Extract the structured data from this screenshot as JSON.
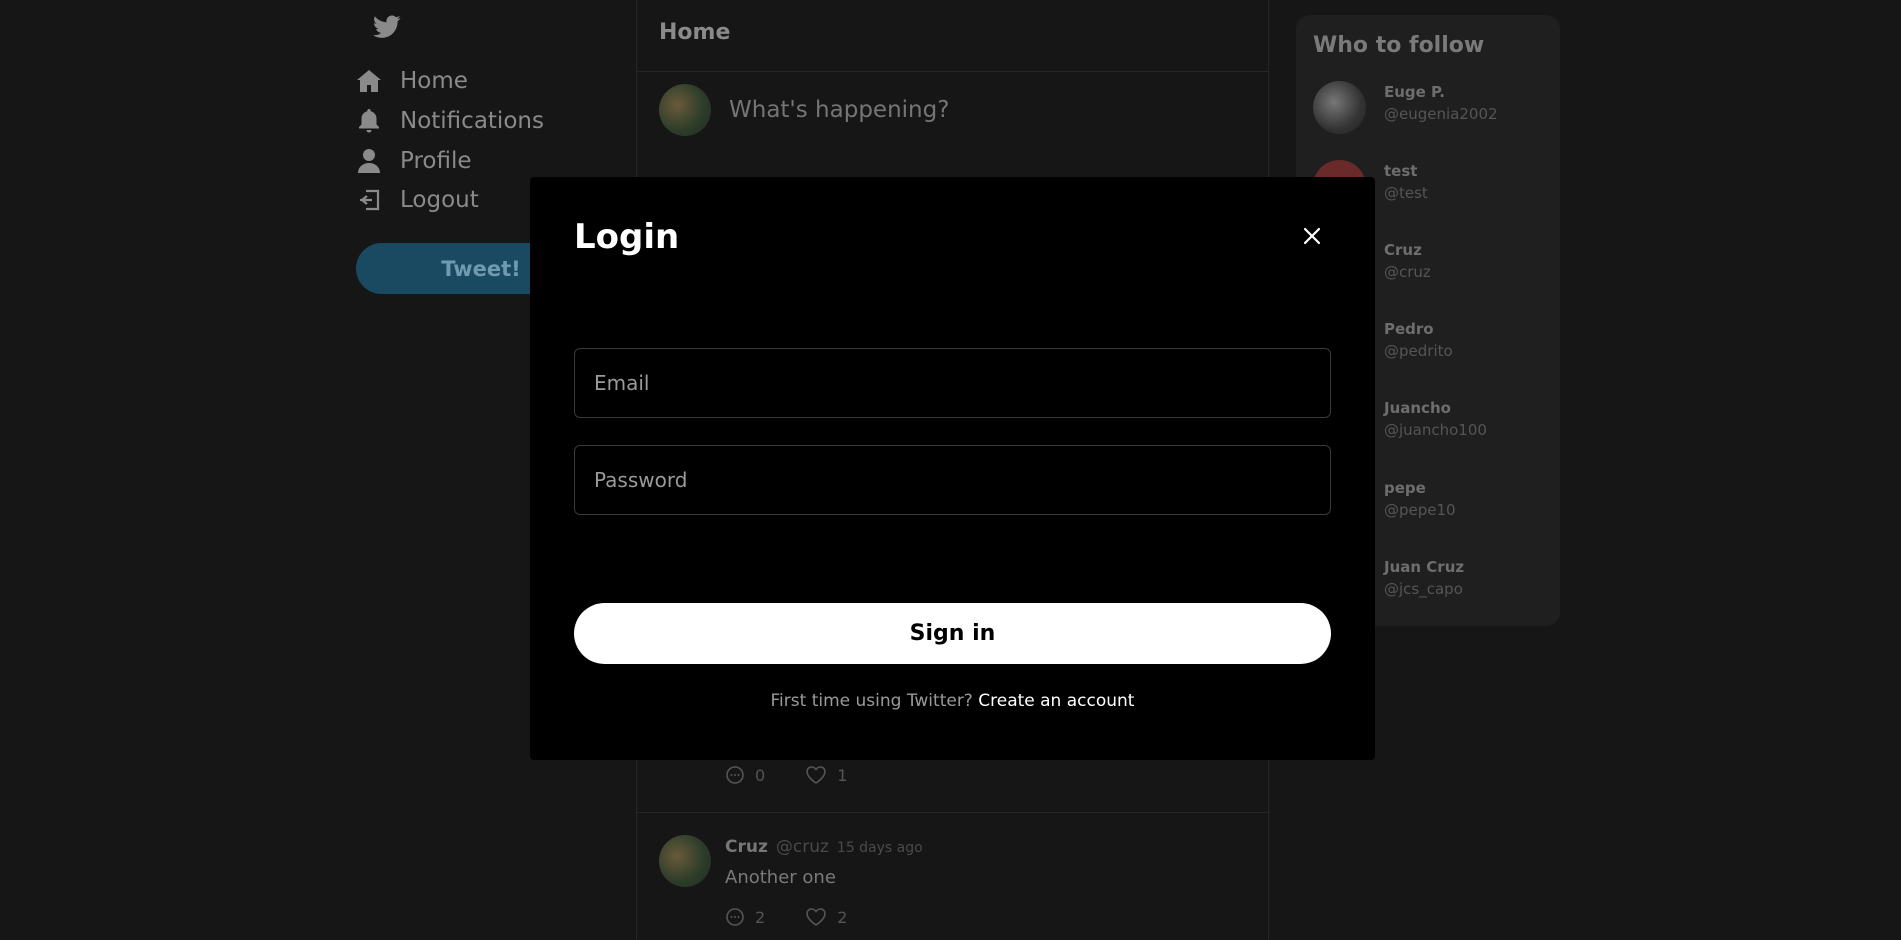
{
  "nav": {
    "logo_icon": "twitter-bird-icon",
    "items": [
      {
        "label": "Home",
        "icon": "home-icon"
      },
      {
        "label": "Notifications",
        "icon": "bell-icon"
      },
      {
        "label": "Profile",
        "icon": "user-icon"
      },
      {
        "label": "Logout",
        "icon": "logout-icon"
      }
    ],
    "tweet_button": "Tweet!"
  },
  "center": {
    "title": "Home",
    "compose_placeholder": "What's happening?",
    "tweets": [
      {
        "comments": "0",
        "likes": "1"
      },
      {
        "name": "Cruz",
        "handle": "@cruz",
        "time": "15 days ago",
        "text": "Another one",
        "comments": "2",
        "likes": "2"
      }
    ]
  },
  "who_to_follow": {
    "title": "Who to follow",
    "users": [
      {
        "name": "Euge P.",
        "handle": "@eugenia2002"
      },
      {
        "name": "test",
        "handle": "@test"
      },
      {
        "name": "Cruz",
        "handle": "@cruz"
      },
      {
        "name": "Pedro",
        "handle": "@pedrito"
      },
      {
        "name": "Juancho",
        "handle": "@juancho100"
      },
      {
        "name": "pepe",
        "handle": "@pepe10"
      },
      {
        "name": "Juan Cruz",
        "handle": "@jcs_capo"
      }
    ]
  },
  "login_modal": {
    "title": "Login",
    "email_placeholder": "Email",
    "password_placeholder": "Password",
    "sign_in_label": "Sign in",
    "signup_prompt": "First time using Twitter?",
    "signup_link": "Create an account"
  },
  "colors": {
    "background": "#161616",
    "modal_background": "#000000",
    "tweet_button": "#1a4a62",
    "primary_button": "#ffffff"
  }
}
